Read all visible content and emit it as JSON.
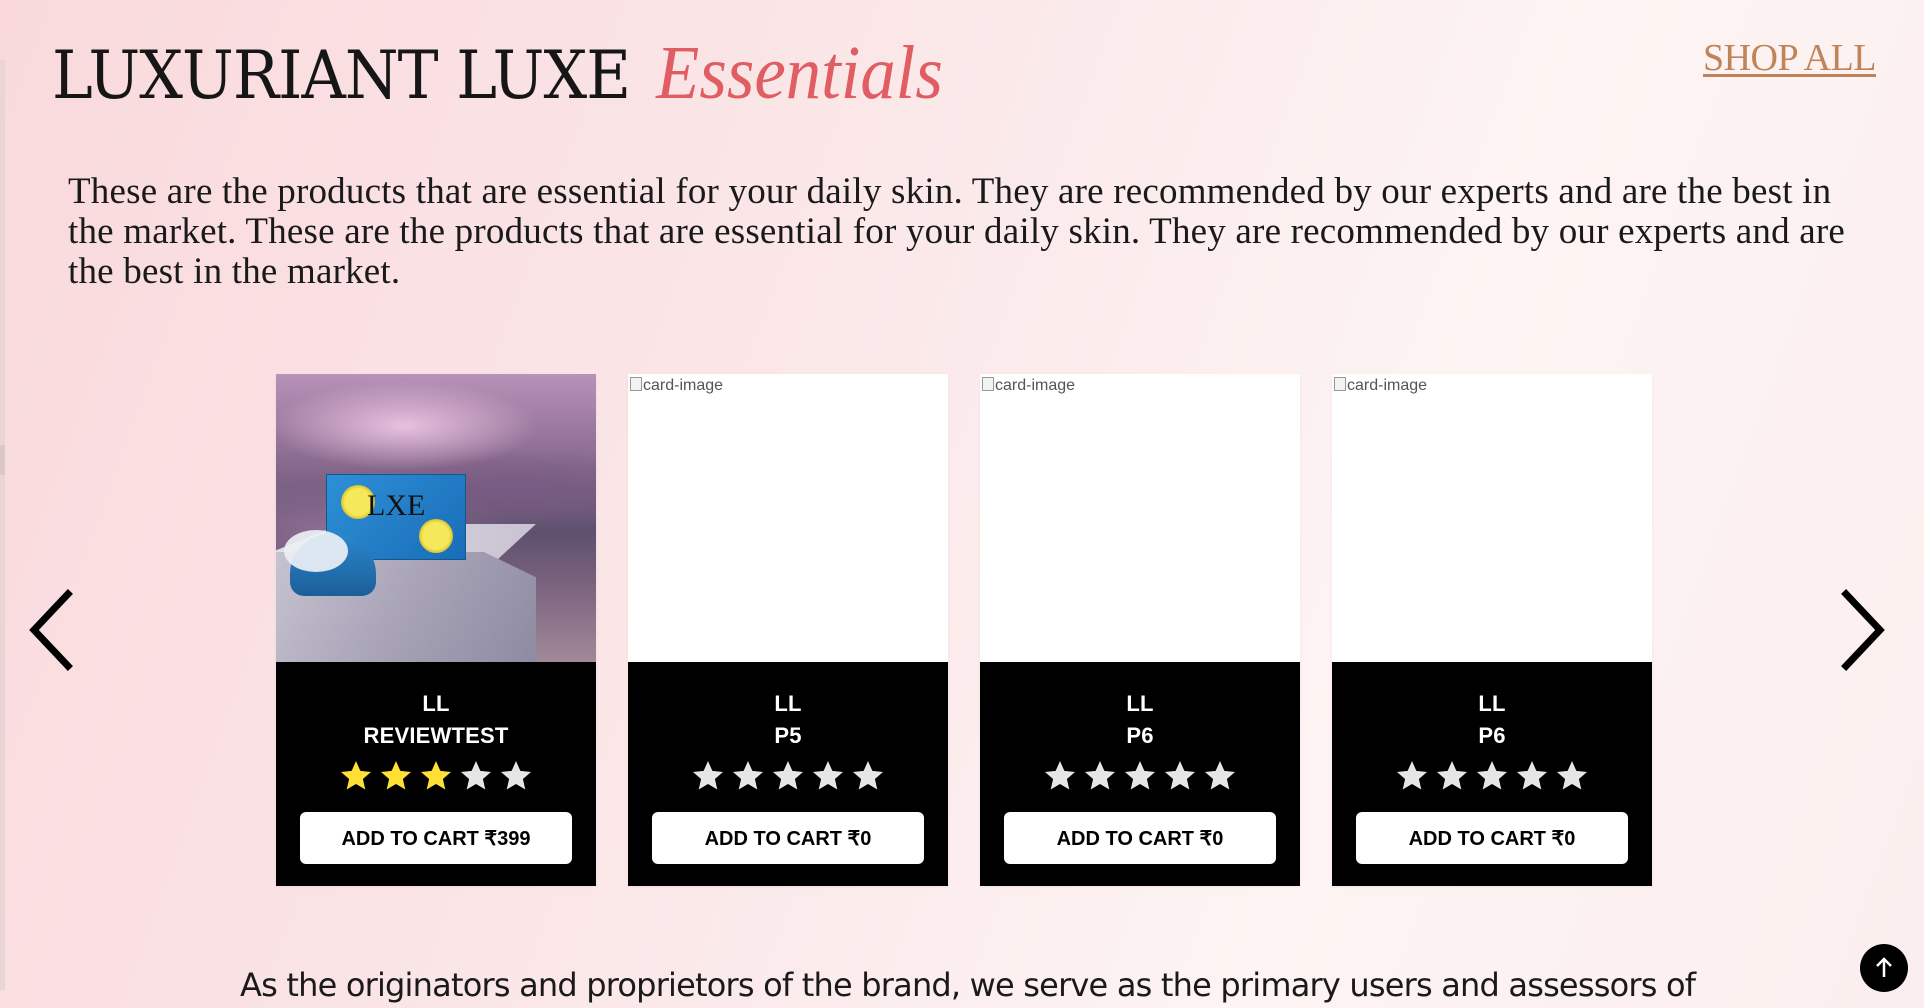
{
  "header": {
    "title_main": "LUXURIANT LUXE",
    "title_accent": "Essentials",
    "shop_all_label": "SHOP ALL"
  },
  "description": "These are the products that are essential for your daily skin. They are recommended by our experts and are the best in the market. These are the products that are essential for your daily skin. They are recommended by our experts and are the best in the market.",
  "carousel": {
    "prev_icon": "chevron-left-icon",
    "next_icon": "chevron-right-icon",
    "cards": [
      {
        "image_alt": "card-image",
        "has_photo": true,
        "brand": "LL",
        "name": "REVIEWTEST",
        "rating": 3,
        "max_rating": 5,
        "button_label": "ADD TO CART ₹399"
      },
      {
        "image_alt": "card-image",
        "has_photo": false,
        "brand": "LL",
        "name": "P5",
        "rating": 0,
        "max_rating": 5,
        "button_label": "ADD TO CART ₹0"
      },
      {
        "image_alt": "card-image",
        "has_photo": false,
        "brand": "LL",
        "name": "P6",
        "rating": 0,
        "max_rating": 5,
        "button_label": "ADD TO CART ₹0"
      },
      {
        "image_alt": "card-image",
        "has_photo": false,
        "brand": "LL",
        "name": "P6",
        "rating": 0,
        "max_rating": 5,
        "button_label": "ADD TO CART ₹0"
      }
    ]
  },
  "bottom_text": "As the originators and proprietors of the brand, we serve as the primary users and assessors of",
  "scroll_top_icon": "arrow-up-icon",
  "colors": {
    "accent": "#e05d63",
    "shop_all": "#c08458",
    "star_filled": "#ffe033",
    "star_empty": "#e6e6e6",
    "card_info_bg": "#000000"
  }
}
